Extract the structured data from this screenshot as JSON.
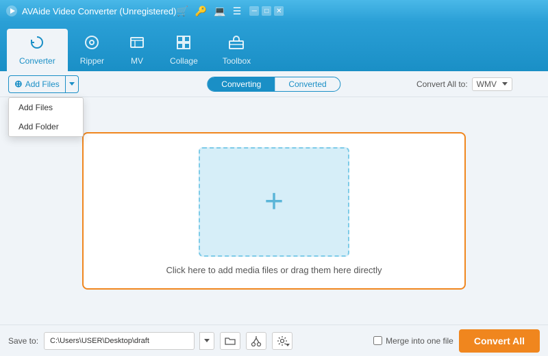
{
  "titleBar": {
    "title": "AVAide Video Converter (Unregistered)"
  },
  "nav": {
    "items": [
      {
        "id": "converter",
        "label": "Converter",
        "icon": "⟳",
        "active": true
      },
      {
        "id": "ripper",
        "label": "Ripper",
        "icon": "⊙"
      },
      {
        "id": "mv",
        "label": "MV",
        "icon": "🖼"
      },
      {
        "id": "collage",
        "label": "Collage",
        "icon": "⊞"
      },
      {
        "id": "toolbox",
        "label": "Toolbox",
        "icon": "🧰"
      }
    ]
  },
  "toolbar": {
    "addFilesLabel": "Add Files",
    "tabs": [
      {
        "id": "converting",
        "label": "Converting",
        "active": true
      },
      {
        "id": "converted",
        "label": "Converted"
      }
    ],
    "convertAllLabel": "Convert All to:",
    "convertFormat": "WMV"
  },
  "dropdown": {
    "items": [
      {
        "id": "add-files",
        "label": "Add Files"
      },
      {
        "id": "add-folder",
        "label": "Add Folder"
      }
    ]
  },
  "dropZone": {
    "plusIcon": "+",
    "text": "Click here to add media files or drag them here directly"
  },
  "bottomBar": {
    "saveLabel": "Save to:",
    "savePath": "C:\\Users\\USER\\Desktop\\draft",
    "mergeLabel": "Merge into one file",
    "convertAllLabel": "Convert All"
  },
  "colors": {
    "accent": "#1a8fc6",
    "orange": "#f0861e",
    "dropZoneBg": "#d6eef8",
    "dropZoneBorder": "#7dcbe8"
  }
}
